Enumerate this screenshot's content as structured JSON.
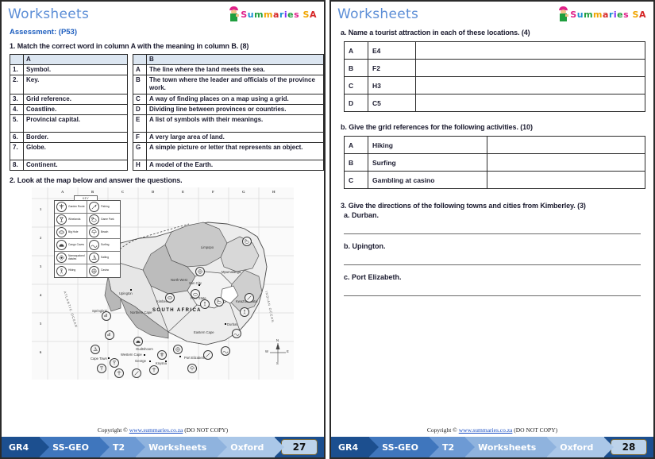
{
  "header": {
    "title": "Worksheets",
    "logo_text": "Summaries SA",
    "logo_colors": [
      "#e0218a",
      "#1f9e3e",
      "#f0a500",
      "#1a8fd1",
      "#d62828"
    ]
  },
  "left_page": {
    "assessment": "Assessment:  (P53)",
    "q1": {
      "text": "1.  Match the correct word in column A with the meaning in column B. (8)",
      "column_a_header": "A",
      "column_b_header": "B",
      "column_a": [
        {
          "num": "1.",
          "label": "Symbol."
        },
        {
          "num": "2.",
          "label": "Key."
        },
        {
          "num": "3.",
          "label": "Grid reference."
        },
        {
          "num": "4.",
          "label": "Coastline."
        },
        {
          "num": "5.",
          "label": "Provincial capital."
        },
        {
          "num": "6.",
          "label": "Border."
        },
        {
          "num": "7.",
          "label": "Globe."
        },
        {
          "num": "8.",
          "label": "Continent."
        }
      ],
      "column_b": [
        {
          "num": "A",
          "label": "The line where the land meets the sea."
        },
        {
          "num": "B",
          "label": "The town where the leader and officials of the province work."
        },
        {
          "num": "C",
          "label": "A way of finding places on a map using a grid."
        },
        {
          "num": "D",
          "label": "Dividing line between provinces or countries."
        },
        {
          "num": "E",
          "label": "A list of symbols with their meanings."
        },
        {
          "num": "F",
          "label": "A very large area of land."
        },
        {
          "num": "G",
          "label": "A simple picture or letter that represents an object."
        },
        {
          "num": "H",
          "label": "A model of the Earth."
        }
      ]
    },
    "q2": {
      "text": "2.  Look at the map below and answer the questions."
    },
    "map": {
      "key_label": "KEY",
      "grid_columns": [
        "A",
        "B",
        "C",
        "D",
        "E",
        "F",
        "G",
        "H"
      ],
      "grid_rows": [
        "1",
        "2",
        "3",
        "4",
        "5",
        "6"
      ],
      "legend": [
        {
          "name": "Garden Route",
          "icon": "tree-icon"
        },
        {
          "name": "Fishing",
          "icon": "fishing-rod-icon"
        },
        {
          "name": "Winelands",
          "icon": "wine-glass-icon"
        },
        {
          "name": "Game Park",
          "icon": "animal-icon"
        },
        {
          "name": "Big Hole",
          "icon": "hole-icon"
        },
        {
          "name": "Beach",
          "icon": "umbrella-icon"
        },
        {
          "name": "Cango Caves",
          "icon": "cave-icon"
        },
        {
          "name": "Surfing",
          "icon": "surf-wave-icon"
        },
        {
          "name": "Namaqualand daisies",
          "icon": "flower-icon"
        },
        {
          "name": "Sailing",
          "icon": "sailboat-icon"
        },
        {
          "name": "Hiking",
          "icon": "hiker-icon"
        },
        {
          "name": "Casino",
          "icon": "casino-chip-icon"
        }
      ],
      "country_label": "SOUTH AFRICA",
      "provinces": [
        "Limpopo",
        "Mpumalanga",
        "North West",
        "Free State",
        "KwaZulu-Natal",
        "Northern Cape",
        "Eastern Cape",
        "Western Cape"
      ],
      "cities": [
        "Sun City",
        "Kimberley",
        "Upington",
        "Springbok",
        "Durban",
        "Cape Town",
        "Oudtshoorn",
        "George",
        "Knysna",
        "Port Elizabeth"
      ],
      "oceans": [
        "ATLANTIC OCEAN",
        "INDIAN OCEAN"
      ],
      "compass": {
        "n": "N",
        "s": "S",
        "e": "E",
        "w": "W"
      }
    },
    "copyright_prefix": "Copyright © ",
    "copyright_link": "www.summaries.co.za",
    "copyright_suffix": " (DO NOT COPY)",
    "footer": {
      "crumbs": [
        "GR4",
        "SS-GEO",
        "T2",
        "Worksheets",
        "Oxford"
      ],
      "page_number": "27"
    }
  },
  "right_page": {
    "qa": {
      "text": "a.  Name a tourist attraction in each of these locations. (4)",
      "rows": [
        {
          "letter": "A",
          "ref": "E4",
          "answer": ""
        },
        {
          "letter": "B",
          "ref": "F2",
          "answer": ""
        },
        {
          "letter": "C",
          "ref": "H3",
          "answer": ""
        },
        {
          "letter": "D",
          "ref": "C5",
          "answer": ""
        }
      ]
    },
    "qb": {
      "text": "b.  Give the grid references for the following activities. (10)",
      "rows": [
        {
          "letter": "A",
          "activity": "Hiking",
          "answer": ""
        },
        {
          "letter": "B",
          "activity": "Surfing",
          "answer": ""
        },
        {
          "letter": "C",
          "activity": "Gambling at casino",
          "answer": ""
        }
      ]
    },
    "q3": {
      "text": "3.  Give the directions of the following towns and cities from Kimberley. (3)",
      "items": [
        "a.  Durban.",
        "b.  Upington.",
        "c.  Port Elizabeth."
      ]
    },
    "copyright_prefix": "Copyright © ",
    "copyright_link": "www.summaries.co.za",
    "copyright_suffix": " (DO NOT COPY)",
    "footer": {
      "crumbs": [
        "GR4",
        "SS-GEO",
        "T2",
        "Worksheets",
        "Oxford"
      ],
      "page_number": "28"
    }
  }
}
